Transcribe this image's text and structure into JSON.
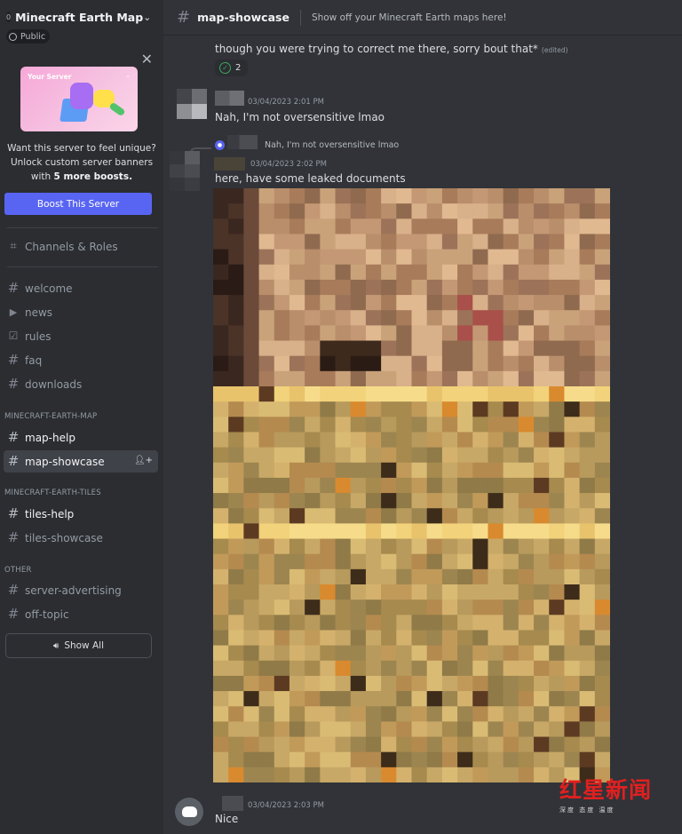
{
  "server": {
    "name": "Minecraft Earth Map",
    "visibility": "Public"
  },
  "boost": {
    "banner_label": "Your Server",
    "text_line1": "Want this server to feel unique?",
    "text_line2": "Unlock custom server banners",
    "text_with": "with",
    "text_bold": "5 more boosts.",
    "button": "Boost This Server"
  },
  "sidebar": {
    "channels_roles": "Channels & Roles",
    "top_channels": [
      "welcome",
      "news",
      "rules",
      "faq",
      "downloads"
    ],
    "categories": [
      {
        "name": "MINECRAFT-EARTH-MAP",
        "channels": [
          "map-help",
          "map-showcase"
        ]
      },
      {
        "name": "MINECRAFT-EARTH-TILES",
        "channels": [
          "tiles-help",
          "tiles-showcase"
        ]
      },
      {
        "name": "OTHER",
        "channels": [
          "server-advertising",
          "off-topic"
        ]
      }
    ],
    "show_all": "Show All"
  },
  "header": {
    "channel": "map-showcase",
    "topic": "Show off your Minecraft Earth maps here!"
  },
  "messages": [
    {
      "text": "though you were trying to correct me there, sorry bout that*",
      "edited": "(edited)",
      "reaction_count": "2"
    },
    {
      "time": "03/04/2023 2:01 PM",
      "text": "Nah, I'm not oversensitive lmao"
    },
    {
      "reply_preview": "Nah, I'm not oversensitive lmao",
      "time": "03/04/2023 2:02 PM",
      "text": "here, have some leaked documents"
    },
    {
      "time": "03/04/2023 2:03 PM",
      "text": "Nice"
    }
  ],
  "watermark": {
    "title": "红星新闻",
    "subtitle": "深度 态度 温度"
  },
  "colors": {
    "accent": "#5865f2",
    "sidebar_bg": "#2b2d31",
    "chat_bg": "#313338",
    "selected_bg": "#404249",
    "reaction_green": "#3ba55d",
    "watermark_red": "#e02020"
  }
}
